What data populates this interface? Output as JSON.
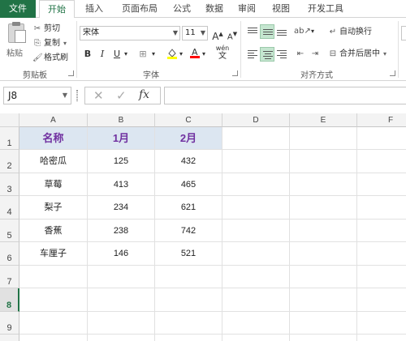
{
  "tabs": [
    {
      "label": "文件"
    },
    {
      "label": "开始"
    },
    {
      "label": "插入"
    },
    {
      "label": "页面布局"
    },
    {
      "label": "公式"
    },
    {
      "label": "数据"
    },
    {
      "label": "审阅"
    },
    {
      "label": "视图"
    },
    {
      "label": "开发工具"
    }
  ],
  "clipboard": {
    "paste": "粘贴",
    "cut": "剪切",
    "copy": "复制",
    "format_painter": "格式刷",
    "group": "剪贴板"
  },
  "font": {
    "name": "宋体",
    "size": "11",
    "group": "字体",
    "bold": "B",
    "italic": "I",
    "underline": "U",
    "grow": "A",
    "shrink": "A",
    "phonetic": "wén",
    "phonetic_char": "文"
  },
  "alignment": {
    "wrap": "自动换行",
    "merge": "合并后居中",
    "group": "对齐方式"
  },
  "formula_bar": {
    "name_box": "J8",
    "fx": "fx",
    "value": ""
  },
  "columns": [
    "A",
    "B",
    "C",
    "D",
    "E",
    "F"
  ],
  "rows": [
    "1",
    "2",
    "3",
    "4",
    "5",
    "6",
    "7",
    "8",
    "9"
  ],
  "table": {
    "headers": [
      "名称",
      "1月",
      "2月"
    ],
    "data": [
      [
        "哈密瓜",
        "125",
        "432"
      ],
      [
        "草莓",
        "413",
        "465"
      ],
      [
        "梨子",
        "234",
        "621"
      ],
      [
        "香蕉",
        "238",
        "742"
      ],
      [
        "车厘子",
        "146",
        "521"
      ]
    ]
  },
  "selected_row": "8",
  "colors": {
    "accent": "#217346",
    "header_fill": "#dce6f1",
    "header_text": "#7030a0"
  }
}
